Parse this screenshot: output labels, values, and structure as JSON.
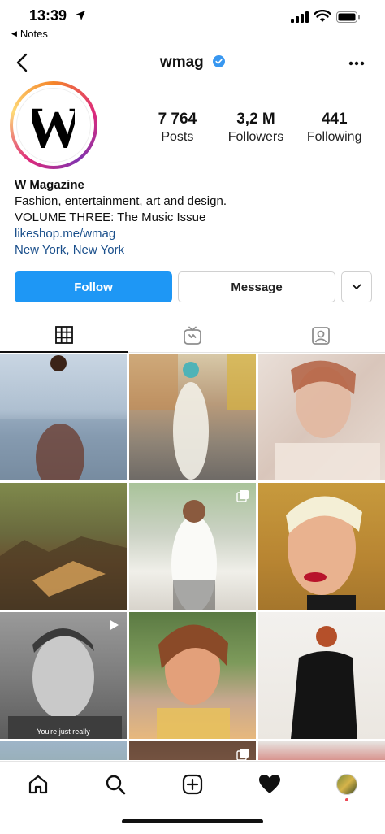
{
  "status_bar": {
    "time": "13:39",
    "back_app": "Notes"
  },
  "header": {
    "username": "wmag",
    "verified": true
  },
  "profile": {
    "avatar_letter": "W",
    "stats": [
      {
        "value": "7 764",
        "label": "Posts"
      },
      {
        "value": "3,2 M",
        "label": "Followers"
      },
      {
        "value": "441",
        "label": "Following"
      }
    ],
    "name": "W Magazine",
    "bio_line1": "Fashion, entertainment, art and design.",
    "bio_line2": "VOLUME THREE: The Music Issue",
    "website": "likeshop.me/wmag",
    "location": "New York, New York"
  },
  "actions": {
    "follow_label": "Follow",
    "message_label": "Message"
  },
  "tabs": [
    {
      "name": "grid",
      "icon": "grid-icon",
      "active": true
    },
    {
      "name": "igtv",
      "icon": "tv-icon",
      "active": false
    },
    {
      "name": "tagged",
      "icon": "tagged-person-icon",
      "active": false
    }
  ],
  "grid_posts": [
    {
      "type": "photo"
    },
    {
      "type": "photo"
    },
    {
      "type": "photo"
    },
    {
      "type": "photo"
    },
    {
      "type": "carousel"
    },
    {
      "type": "photo"
    },
    {
      "type": "video",
      "caption": "You're just really"
    },
    {
      "type": "photo"
    },
    {
      "type": "photo"
    }
  ],
  "colors": {
    "accent": "#1e97f5",
    "link": "#1a4f8b",
    "notification": "#ed4956"
  },
  "bottom_nav": [
    "home-icon",
    "search-icon",
    "new-post-icon",
    "activity-heart-icon",
    "profile-avatar"
  ]
}
